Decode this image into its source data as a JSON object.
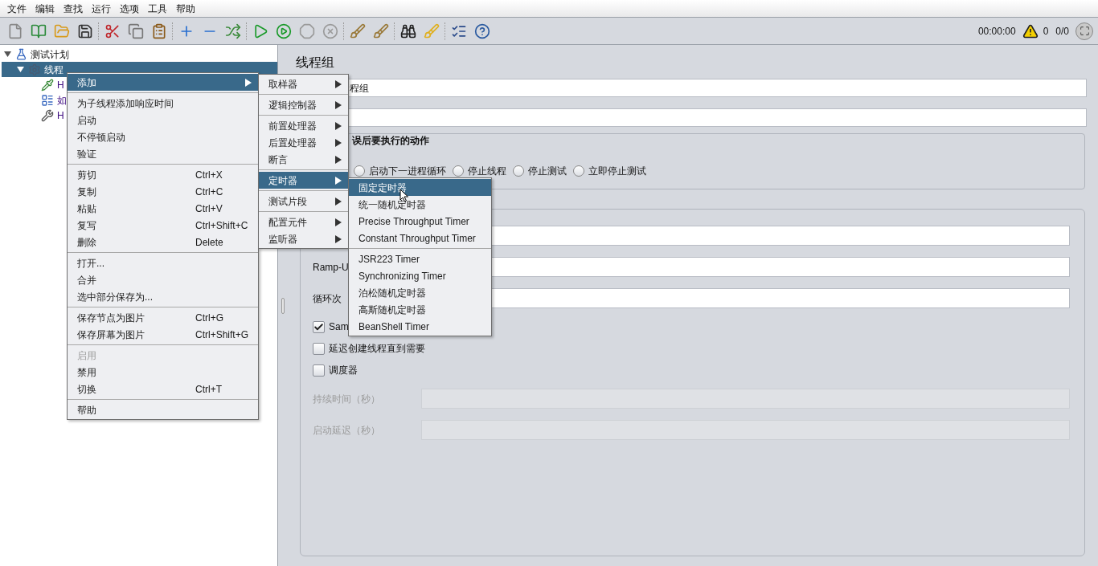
{
  "menubar": [
    "文件",
    "编辑",
    "查找",
    "运行",
    "选项",
    "工具",
    "帮助"
  ],
  "status": {
    "time": "00:00:00",
    "warnings": "0",
    "threads": "0/0"
  },
  "tree": [
    {
      "label": "测试计划",
      "kind": "plan",
      "expanded": true,
      "selected": false,
      "children": [
        {
          "label": "线程",
          "kind": "threads",
          "expanded": true,
          "selected": true,
          "children": [
            {
              "label": "H",
              "kind": "sampler",
              "selected": false
            },
            {
              "label": "如",
              "kind": "controller",
              "selected": false
            },
            {
              "label": "H",
              "kind": "config",
              "selected": false
            }
          ]
        }
      ]
    }
  ],
  "form": {
    "title": "线程组",
    "name_value": "程组",
    "on_error": {
      "title": "误后要执行的动作",
      "options": [
        {
          "label": "启动下一进程循环",
          "selected": false
        },
        {
          "label": "停止线程",
          "selected": false
        },
        {
          "label": "停止测试",
          "selected": false
        },
        {
          "label": "立即停止测试",
          "selected": false
        }
      ]
    },
    "rows": [
      {
        "kind": "field",
        "disabled": false
      },
      {
        "kind": "field",
        "label": "Ramp-U",
        "disabled": false
      },
      {
        "kind": "field",
        "label": "循环次",
        "disabled": false
      },
      {
        "kind": "checkbox",
        "label": "Sam",
        "checked": true
      },
      {
        "kind": "checkbox",
        "label": "延迟创建线程直到需要",
        "checked": false
      },
      {
        "kind": "checkbox",
        "label": "调度器",
        "checked": false
      },
      {
        "kind": "field",
        "label": "持续时间（秒）",
        "disabled": true
      },
      {
        "kind": "field",
        "label": "启动延迟（秒）",
        "disabled": true
      }
    ]
  },
  "context_menu": [
    [
      {
        "label": "添加",
        "submenu": true,
        "selected": true,
        "disabled": false
      }
    ],
    [
      {
        "label": "为子线程添加响应时间",
        "submenu": false,
        "selected": false,
        "disabled": false
      },
      {
        "label": "启动",
        "submenu": false,
        "selected": false,
        "disabled": false
      },
      {
        "label": "不停顿启动",
        "submenu": false,
        "selected": false,
        "disabled": false
      },
      {
        "label": "验证",
        "submenu": false,
        "selected": false,
        "disabled": false
      }
    ],
    [
      {
        "label": "剪切",
        "shortcut": "Ctrl+X",
        "submenu": false,
        "selected": false,
        "disabled": false
      },
      {
        "label": "复制",
        "shortcut": "Ctrl+C",
        "submenu": false,
        "selected": false,
        "disabled": false
      },
      {
        "label": "粘贴",
        "shortcut": "Ctrl+V",
        "submenu": false,
        "selected": false,
        "disabled": false
      },
      {
        "label": "复写",
        "shortcut": "Ctrl+Shift+C",
        "submenu": false,
        "selected": false,
        "disabled": false
      },
      {
        "label": "删除",
        "shortcut": "Delete",
        "submenu": false,
        "selected": false,
        "disabled": false
      }
    ],
    [
      {
        "label": "打开...",
        "submenu": false,
        "selected": false,
        "disabled": false
      },
      {
        "label": "合并",
        "submenu": false,
        "selected": false,
        "disabled": false
      },
      {
        "label": "选中部分保存为...",
        "submenu": false,
        "selected": false,
        "disabled": false
      }
    ],
    [
      {
        "label": "保存节点为图片",
        "shortcut": "Ctrl+G",
        "submenu": false,
        "selected": false,
        "disabled": false
      },
      {
        "label": "保存屏幕为图片",
        "shortcut": "Ctrl+Shift+G",
        "submenu": false,
        "selected": false,
        "disabled": false
      }
    ],
    [
      {
        "label": "启用",
        "submenu": false,
        "selected": false,
        "disabled": true
      },
      {
        "label": "禁用",
        "submenu": false,
        "selected": false,
        "disabled": false
      },
      {
        "label": "切换",
        "shortcut": "Ctrl+T",
        "submenu": false,
        "selected": false,
        "disabled": false
      }
    ],
    [
      {
        "label": "帮助",
        "submenu": false,
        "selected": false,
        "disabled": false
      }
    ]
  ],
  "add_submenu": [
    [
      {
        "label": "取样器",
        "submenu": true,
        "selected": false,
        "disabled": false
      }
    ],
    [
      {
        "label": "逻辑控制器",
        "submenu": true,
        "selected": false,
        "disabled": false
      }
    ],
    [
      {
        "label": "前置处理器",
        "submenu": true,
        "selected": false,
        "disabled": false
      },
      {
        "label": "后置处理器",
        "submenu": true,
        "selected": false,
        "disabled": false
      },
      {
        "label": "断言",
        "submenu": true,
        "selected": false,
        "disabled": false
      }
    ],
    [
      {
        "label": "定时器",
        "submenu": true,
        "selected": true,
        "disabled": false
      }
    ],
    [
      {
        "label": "测试片段",
        "submenu": true,
        "selected": false,
        "disabled": false
      }
    ],
    [
      {
        "label": "配置元件",
        "submenu": true,
        "selected": false,
        "disabled": false
      },
      {
        "label": "监听器",
        "submenu": true,
        "selected": false,
        "disabled": false
      }
    ]
  ],
  "timer_submenu": [
    [
      {
        "label": "固定定时器",
        "submenu": false,
        "selected": true,
        "disabled": false
      },
      {
        "label": "统一随机定时器",
        "submenu": false,
        "selected": false,
        "disabled": false
      },
      {
        "label": "Precise Throughput Timer",
        "submenu": false,
        "selected": false,
        "disabled": false
      },
      {
        "label": "Constant Throughput Timer",
        "submenu": false,
        "selected": false,
        "disabled": false
      }
    ],
    [
      {
        "label": "JSR223 Timer",
        "submenu": false,
        "selected": false,
        "disabled": false
      },
      {
        "label": "Synchronizing Timer",
        "submenu": false,
        "selected": false,
        "disabled": false
      },
      {
        "label": "泊松随机定时器",
        "submenu": false,
        "selected": false,
        "disabled": false
      },
      {
        "label": "高斯随机定时器",
        "submenu": false,
        "selected": false,
        "disabled": false
      },
      {
        "label": "BeanShell Timer",
        "submenu": false,
        "selected": false,
        "disabled": false
      }
    ]
  ]
}
